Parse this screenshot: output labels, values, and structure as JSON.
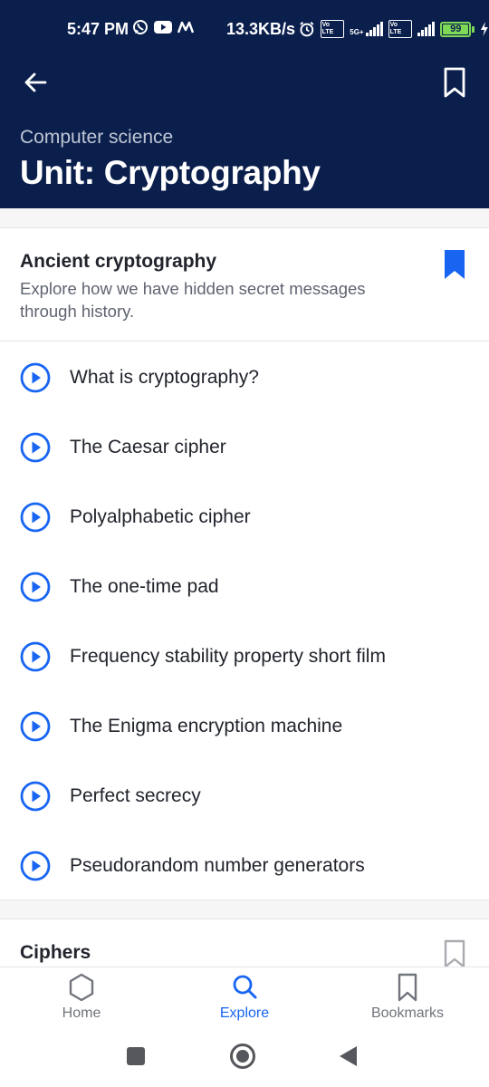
{
  "status_bar": {
    "time": "5:47 PM",
    "speed": "13.3KB/s",
    "sim1": "Vo LTE",
    "network": "5G+",
    "sim2": "Vo LTE",
    "battery": "99",
    "icons": [
      "whatsapp-icon",
      "youtube-icon",
      "m-icon",
      "alarm-icon",
      "charging-icon"
    ]
  },
  "header": {
    "back_icon": "arrow-left-icon",
    "bookmark_icon": "bookmark-outline-icon",
    "subject": "Computer science",
    "title": "Unit: Cryptography"
  },
  "lesson": {
    "title": "Ancient cryptography",
    "description": "Explore how we have hidden secret messages through history.",
    "bookmarked": true,
    "items": [
      {
        "label": "What is cryptography?"
      },
      {
        "label": "The Caesar cipher"
      },
      {
        "label": "Polyalphabetic cipher"
      },
      {
        "label": "The one-time pad"
      },
      {
        "label": "Frequency stability property short film"
      },
      {
        "label": "The Enigma encryption machine"
      },
      {
        "label": "Perfect secrecy"
      },
      {
        "label": "Pseudorandom number generators"
      }
    ]
  },
  "next_lesson": {
    "title": "Ciphers",
    "bookmarked": false
  },
  "tabs": [
    {
      "label": "Home",
      "icon": "hexagon-icon",
      "active": false
    },
    {
      "label": "Explore",
      "icon": "search-icon",
      "active": true
    },
    {
      "label": "Bookmarks",
      "icon": "bookmark-icon",
      "active": false
    }
  ],
  "colors": {
    "header_bg": "#0b1f4d",
    "accent": "#1865f2",
    "battery": "#7ed957"
  }
}
